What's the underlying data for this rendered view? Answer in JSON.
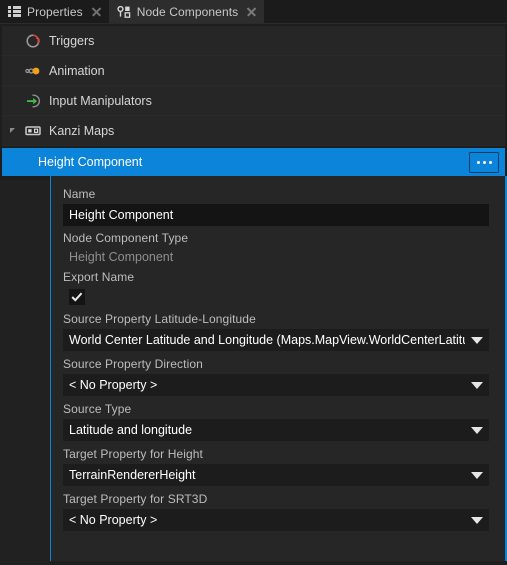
{
  "window": {
    "accent_color": "#0b84d9",
    "background": "#1e1e1e"
  },
  "tabs": [
    {
      "label": "Properties",
      "icon": "list-icon",
      "active": false,
      "closable": true
    },
    {
      "label": "Node Components",
      "icon": "node-components-icon",
      "active": true,
      "closable": true
    }
  ],
  "component_list": [
    {
      "label": "Triggers",
      "icon": "triggers-icon"
    },
    {
      "label": "Animation",
      "icon": "animation-icon"
    },
    {
      "label": "Input Manipulators",
      "icon": "input-manipulators-icon"
    },
    {
      "label": "Kanzi Maps",
      "icon": "kanzi-maps-icon",
      "expanded": true
    }
  ],
  "selected_component": {
    "label": "Height Component",
    "menu_button": "ellipsis-button"
  },
  "editor": {
    "fields": [
      {
        "type": "text",
        "label": "Name",
        "value": "Height Component"
      },
      {
        "type": "readonly",
        "label": "Node Component Type",
        "value": "Height Component"
      },
      {
        "type": "checkbox",
        "label": "Export Name",
        "checked": true
      },
      {
        "type": "select",
        "label": "Source Property Latitude-Longitude",
        "value": "World Center Latitude and Longitude (Maps.MapView.WorldCenterLatitude)"
      },
      {
        "type": "select",
        "label": "Source Property Direction",
        "value": "< No Property >"
      },
      {
        "type": "select",
        "label": "Source Type",
        "value": "Latitude and longitude"
      },
      {
        "type": "select",
        "label": "Target Property for Height",
        "value": "TerrainRendererHeight"
      },
      {
        "type": "select",
        "label": "Target Property for SRT3D",
        "value": "< No Property >"
      }
    ]
  }
}
